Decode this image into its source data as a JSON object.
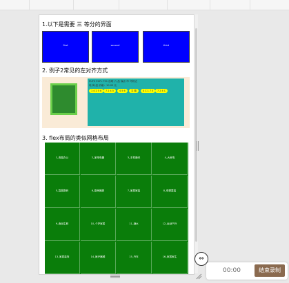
{
  "section1": {
    "title": "1.以下是需要 三 等分的界面",
    "boxes": [
      "first",
      "second",
      "third"
    ]
  },
  "section2": {
    "title": "2. 例子2常见的左对齐方式",
    "line1": "EUFS EUFL FS1 自助 六 品 保点 市 乌机达",
    "line2": "电 商 品 价格：10.00 元",
    "tags": [
      "1 4 2 5 8",
      "7 2 4 5",
      "4 5 6",
      "文 图",
      "4 C 1 7 5",
      "7 2 4 C"
    ]
  },
  "section3": {
    "title": "3. flex布局的类似网格布局",
    "cells": [
      "1_电脑办公",
      "2_家用电器",
      "3_手机通讯",
      "4_大家电",
      "5_智能数码",
      "6_厨房器具",
      "7_家居家装",
      "8_母婴童装",
      "9_食品生鲜",
      "10_个护家居",
      "11_酒水",
      "12_运动户外",
      "13_家居装饰",
      "14_医疗器械",
      "15_汽车",
      "16_家居家生"
    ]
  },
  "recorder": {
    "time": "00:00",
    "stop_label": "结束录制",
    "swap_glyph": "⇔"
  },
  "icons": {
    "swap": "swap-horizontal-icon",
    "resize": "resize-corner-icon"
  }
}
